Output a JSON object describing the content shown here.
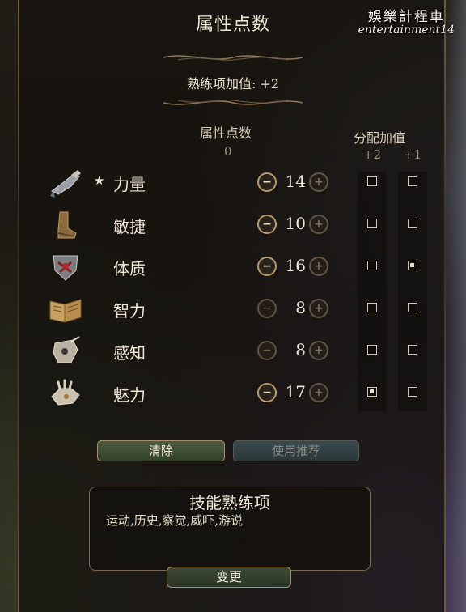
{
  "title": "属性点数",
  "watermark": {
    "line1": "娛樂計程車",
    "line2": "entertainment14"
  },
  "proficiency_bonus_text": "熟练项加值: +2",
  "points_header": {
    "label": "属性点数",
    "value": "0"
  },
  "assign_header": {
    "label": "分配加值",
    "plus2": "+2",
    "plus1": "+1"
  },
  "abilities": [
    {
      "name": "力量",
      "value": "14",
      "starred": true,
      "icon": "gauntlet-icon",
      "minus_enabled": true,
      "bonus2": false,
      "bonus1": false
    },
    {
      "name": "敏捷",
      "value": "10",
      "starred": false,
      "icon": "boot-icon",
      "minus_enabled": true,
      "bonus2": false,
      "bonus1": false
    },
    {
      "name": "体质",
      "value": "16",
      "starred": false,
      "icon": "shield-icon",
      "minus_enabled": true,
      "bonus2": false,
      "bonus1": true
    },
    {
      "name": "智力",
      "value": "8",
      "starred": false,
      "icon": "book-icon",
      "minus_enabled": false,
      "bonus2": false,
      "bonus1": false
    },
    {
      "name": "感知",
      "value": "8",
      "starred": false,
      "icon": "eye-icon",
      "minus_enabled": false,
      "bonus2": false,
      "bonus1": false
    },
    {
      "name": "魅力",
      "value": "17",
      "starred": false,
      "icon": "hand-icon",
      "minus_enabled": true,
      "bonus2": true,
      "bonus1": false
    }
  ],
  "star_symbol": "★",
  "minus_symbol": "−",
  "plus_symbol": "+",
  "buttons": {
    "clear": "清除",
    "recommend": "使用推荐",
    "change": "变更"
  },
  "skills": {
    "title": "技能熟练项",
    "list": "运动,历史,察觉,威吓,游说"
  }
}
